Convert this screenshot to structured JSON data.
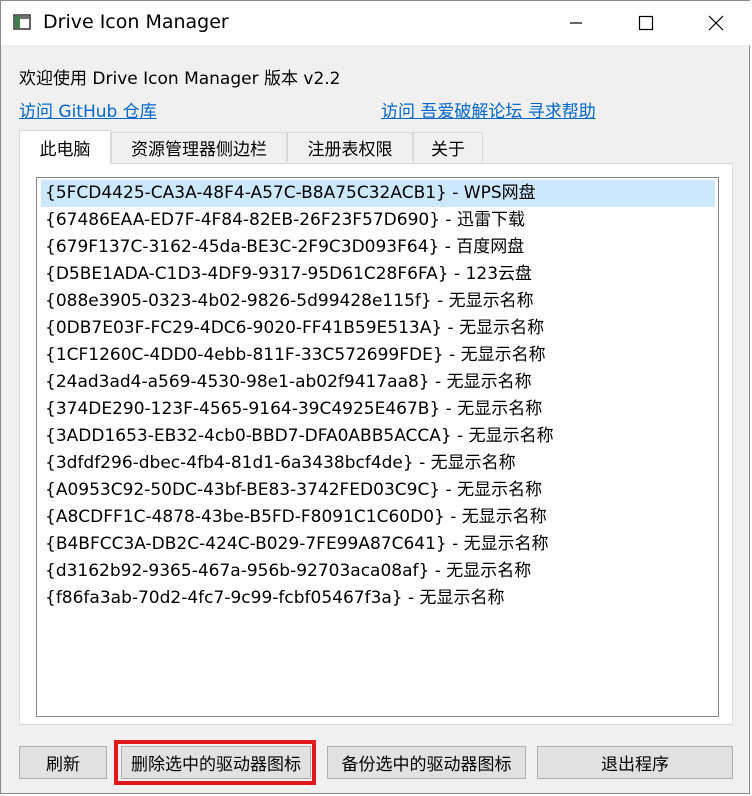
{
  "window": {
    "title": "Drive Icon Manager",
    "icons": [
      "app-icon",
      "minimize-icon",
      "maximize-icon",
      "close-icon"
    ]
  },
  "header": {
    "welcome": "欢迎使用 Drive Icon Manager 版本 v2.2",
    "github_link": "访问 GitHub 仓库",
    "forum_link": "访问 吾爱破解论坛 寻求帮助"
  },
  "tabs": [
    {
      "label": "此电脑",
      "active": true
    },
    {
      "label": "资源管理器侧边栏",
      "active": false
    },
    {
      "label": "注册表权限",
      "active": false
    },
    {
      "label": "关于",
      "active": false
    }
  ],
  "list": {
    "selected_index": 0,
    "items": [
      "{5FCD4425-CA3A-48F4-A57C-B8A75C32ACB1} - WPS网盘",
      "{67486EAA-ED7F-4F84-82EB-26F23F57D690} - 迅雷下载",
      "{679F137C-3162-45da-BE3C-2F9C3D093F64} - 百度网盘",
      "{D5BE1ADA-C1D3-4DF9-9317-95D61C28F6FA} - 123云盘",
      "{088e3905-0323-4b02-9826-5d99428e115f} - 无显示名称",
      "{0DB7E03F-FC29-4DC6-9020-FF41B59E513A} - 无显示名称",
      "{1CF1260C-4DD0-4ebb-811F-33C572699FDE} - 无显示名称",
      "{24ad3ad4-a569-4530-98e1-ab02f9417aa8} - 无显示名称",
      "{374DE290-123F-4565-9164-39C4925E467B} - 无显示名称",
      "{3ADD1653-EB32-4cb0-BBD7-DFA0ABB5ACCA} - 无显示名称",
      "{3dfdf296-dbec-4fb4-81d1-6a3438bcf4de} - 无显示名称",
      "{A0953C92-50DC-43bf-BE83-3742FED03C9C} - 无显示名称",
      "{A8CDFF1C-4878-43be-B5FD-F8091C1C60D0} - 无显示名称",
      "{B4BFCC3A-DB2C-424C-B029-7FE99A87C641} - 无显示名称",
      "{d3162b92-9365-467a-956b-92703aca08af} - 无显示名称",
      "{f86fa3ab-70d2-4fc7-9c99-fcbf05467f3a} - 无显示名称"
    ]
  },
  "buttons": {
    "refresh": "刷新",
    "delete_selected": "删除选中的驱动器图标",
    "backup_selected": "备份选中的驱动器图标",
    "exit": "退出程序"
  },
  "colors": {
    "link": "#0066cc",
    "selection": "#cce8ff",
    "highlight_box": "#e01818"
  }
}
